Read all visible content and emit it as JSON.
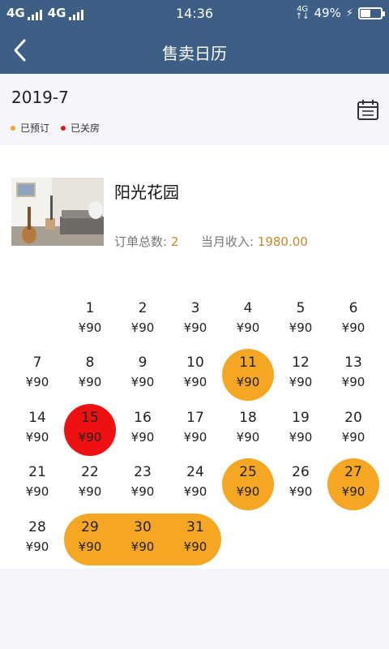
{
  "status_bar": {
    "net1": "4G",
    "net2": "4G",
    "time": "14:36",
    "net3_top": "4G",
    "net3_bottom": "↑↓",
    "battery_text": "49%",
    "battery_level": 0.49
  },
  "nav": {
    "title": "售卖日历"
  },
  "month": {
    "label": "2019-7",
    "legend": [
      {
        "label": "已预订",
        "color": "#f5a623"
      },
      {
        "label": "已关房",
        "color": "#ee1111"
      }
    ]
  },
  "house": {
    "name": "阳光花园",
    "orders_label": "订单总数:",
    "orders_value": "2",
    "income_label": "当月收入:",
    "income_value": "1980.00"
  },
  "calendar": {
    "first_weekday_col": 1,
    "days": [
      {
        "day": "1",
        "price": "¥90",
        "status": ""
      },
      {
        "day": "2",
        "price": "¥90",
        "status": ""
      },
      {
        "day": "3",
        "price": "¥90",
        "status": ""
      },
      {
        "day": "4",
        "price": "¥90",
        "status": ""
      },
      {
        "day": "5",
        "price": "¥90",
        "status": ""
      },
      {
        "day": "6",
        "price": "¥90",
        "status": ""
      },
      {
        "day": "7",
        "price": "¥90",
        "status": ""
      },
      {
        "day": "8",
        "price": "¥90",
        "status": ""
      },
      {
        "day": "9",
        "price": "¥90",
        "status": ""
      },
      {
        "day": "10",
        "price": "¥90",
        "status": ""
      },
      {
        "day": "11",
        "price": "¥90",
        "status": "booked"
      },
      {
        "day": "12",
        "price": "¥90",
        "status": ""
      },
      {
        "day": "13",
        "price": "¥90",
        "status": ""
      },
      {
        "day": "14",
        "price": "¥90",
        "status": ""
      },
      {
        "day": "15",
        "price": "¥90",
        "status": "closed"
      },
      {
        "day": "16",
        "price": "¥90",
        "status": ""
      },
      {
        "day": "17",
        "price": "¥90",
        "status": ""
      },
      {
        "day": "18",
        "price": "¥90",
        "status": ""
      },
      {
        "day": "19",
        "price": "¥90",
        "status": ""
      },
      {
        "day": "20",
        "price": "¥90",
        "status": ""
      },
      {
        "day": "21",
        "price": "¥90",
        "status": ""
      },
      {
        "day": "22",
        "price": "¥90",
        "status": ""
      },
      {
        "day": "23",
        "price": "¥90",
        "status": ""
      },
      {
        "day": "24",
        "price": "¥90",
        "status": ""
      },
      {
        "day": "25",
        "price": "¥90",
        "status": "booked"
      },
      {
        "day": "26",
        "price": "¥90",
        "status": ""
      },
      {
        "day": "27",
        "price": "¥90",
        "status": "booked"
      },
      {
        "day": "28",
        "price": "¥90",
        "status": ""
      },
      {
        "day": "29",
        "price": "¥90",
        "status": "booked"
      },
      {
        "day": "30",
        "price": "¥90",
        "status": "booked"
      },
      {
        "day": "31",
        "price": "¥90",
        "status": "booked"
      }
    ]
  },
  "colors": {
    "header_bg": "#3d5f85",
    "booked": "#f5a623",
    "closed": "#ee1111",
    "accent_text": "#c8862a"
  },
  "icons": {
    "back": "chevron-left-icon",
    "calendar": "calendar-icon"
  }
}
